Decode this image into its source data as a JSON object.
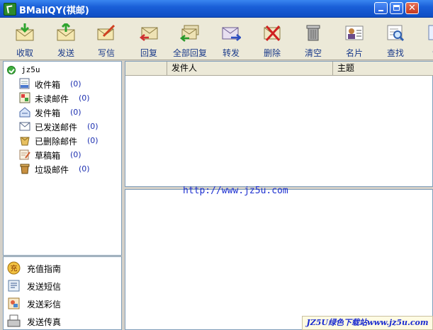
{
  "window": {
    "title": "BMailQY(祺邮)",
    "minimize_icon": "minimize-icon",
    "maximize_icon": "maximize-icon",
    "close_icon": "close-icon"
  },
  "toolbar": {
    "buttons": [
      {
        "label": "收取",
        "icon": "receive-mail-icon"
      },
      {
        "label": "发送",
        "icon": "send-mail-icon"
      },
      {
        "label": "写信",
        "icon": "compose-icon"
      },
      {
        "label": "回复",
        "icon": "reply-icon"
      },
      {
        "label": "全部回复",
        "icon": "reply-all-icon"
      },
      {
        "label": "转发",
        "icon": "forward-icon"
      },
      {
        "label": "删除",
        "icon": "delete-icon"
      },
      {
        "label": "清空",
        "icon": "trash-can-icon"
      },
      {
        "label": "名片",
        "icon": "business-card-icon"
      },
      {
        "label": "查找",
        "icon": "find-icon"
      },
      {
        "label": "设",
        "icon": "settings-icon"
      }
    ]
  },
  "tree": {
    "account": "jz5u",
    "folders": [
      {
        "label": "收件箱",
        "count": "(0)",
        "icon": "inbox-icon"
      },
      {
        "label": "未读邮件",
        "count": "(0)",
        "icon": "unread-mail-icon"
      },
      {
        "label": "发件箱",
        "count": "(0)",
        "icon": "outbox-icon"
      },
      {
        "label": "已发送邮件",
        "count": "(0)",
        "icon": "sent-mail-icon"
      },
      {
        "label": "已删除邮件",
        "count": "(0)",
        "icon": "deleted-mail-icon"
      },
      {
        "label": "草稿箱",
        "count": "(0)",
        "icon": "drafts-icon"
      },
      {
        "label": "垃圾邮件",
        "count": "(0)",
        "icon": "junk-mail-icon"
      }
    ]
  },
  "services": [
    {
      "label": "充值指南",
      "icon": "recharge-icon"
    },
    {
      "label": "发送短信",
      "icon": "sms-icon"
    },
    {
      "label": "发送彩信",
      "icon": "mms-icon"
    },
    {
      "label": "发送传真",
      "icon": "fax-icon"
    }
  ],
  "message_list": {
    "columns": [
      "",
      "发件人",
      "主题"
    ]
  },
  "preview": {
    "link": "http://www.jz5u.com"
  },
  "watermark": "JZ5U绿色下载站www.jz5u.com",
  "colors": {
    "title_bar": "#1a5fd8",
    "toolbar_label": "#1a3a8a",
    "count": "#1c2fb0",
    "link": "#1c2fd0"
  }
}
